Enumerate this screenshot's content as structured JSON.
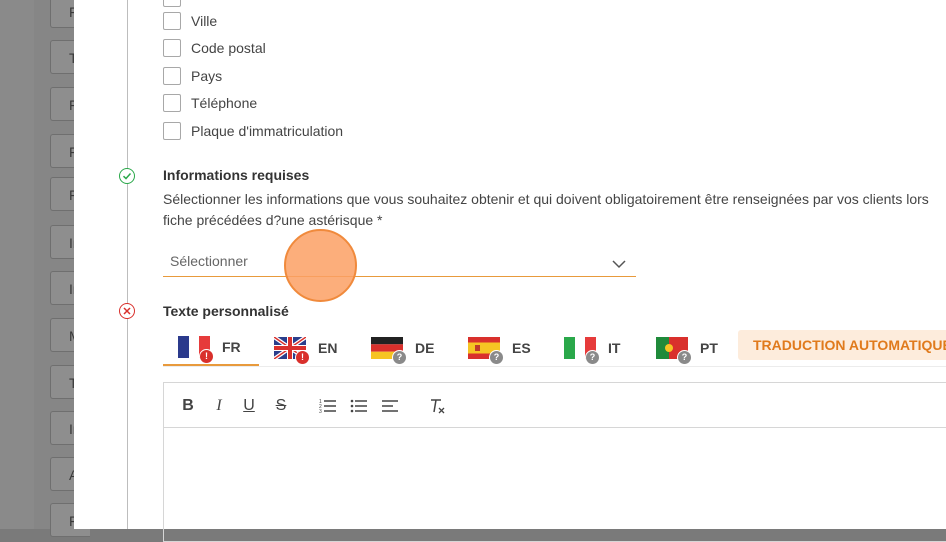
{
  "background_menu": {
    "items": [
      "F",
      "T",
      "F",
      "F",
      "F",
      "In",
      "In",
      "M",
      "T",
      "In",
      "A",
      "F"
    ]
  },
  "checkboxes": [
    {
      "label": "Ville",
      "checked": false
    },
    {
      "label": "Code postal",
      "checked": false
    },
    {
      "label": "Pays",
      "checked": false
    },
    {
      "label": "Téléphone",
      "checked": false
    },
    {
      "label": "Plaque d'immatriculation",
      "checked": false
    }
  ],
  "required_info": {
    "title": "Informations requises",
    "description_line1": "Sélectionner les informations que vous souhaitez obtenir et qui doivent obligatoirement être renseignées par vos clients lors",
    "description_line2": "fiche précédées d?une astérisque *",
    "select_placeholder": "Sélectionner",
    "status": "complete"
  },
  "custom_text": {
    "title": "Texte personnalisé",
    "status": "error",
    "languages": [
      {
        "code": "FR",
        "badge": "!",
        "badge_color": "#d9302c",
        "active": true
      },
      {
        "code": "EN",
        "badge": "!",
        "badge_color": "#d9302c",
        "active": false
      },
      {
        "code": "DE",
        "badge": "?",
        "badge_color": "#8a8a8a",
        "active": false
      },
      {
        "code": "ES",
        "badge": "?",
        "badge_color": "#8a8a8a",
        "active": false
      },
      {
        "code": "IT",
        "badge": "?",
        "badge_color": "#8a8a8a",
        "active": false
      },
      {
        "code": "PT",
        "badge": "?",
        "badge_color": "#8a8a8a",
        "active": false
      }
    ],
    "auto_translate_label": "TRADUCTION AUTOMATIQUE",
    "toolbar": [
      {
        "icon": "bold-icon",
        "glyph": "B"
      },
      {
        "icon": "italic-icon",
        "glyph": "I"
      },
      {
        "icon": "underline-icon",
        "glyph": "U"
      },
      {
        "icon": "strikethrough-icon",
        "glyph": "S"
      },
      {
        "icon": "ordered-list-icon",
        "glyph": ""
      },
      {
        "icon": "bullet-list-icon",
        "glyph": ""
      },
      {
        "icon": "align-left-icon",
        "glyph": ""
      },
      {
        "icon": "clear-format-icon",
        "glyph": "T"
      }
    ]
  },
  "colors": {
    "accent": "#e89a3c",
    "success": "#2aa84a",
    "error": "#d9302c"
  }
}
